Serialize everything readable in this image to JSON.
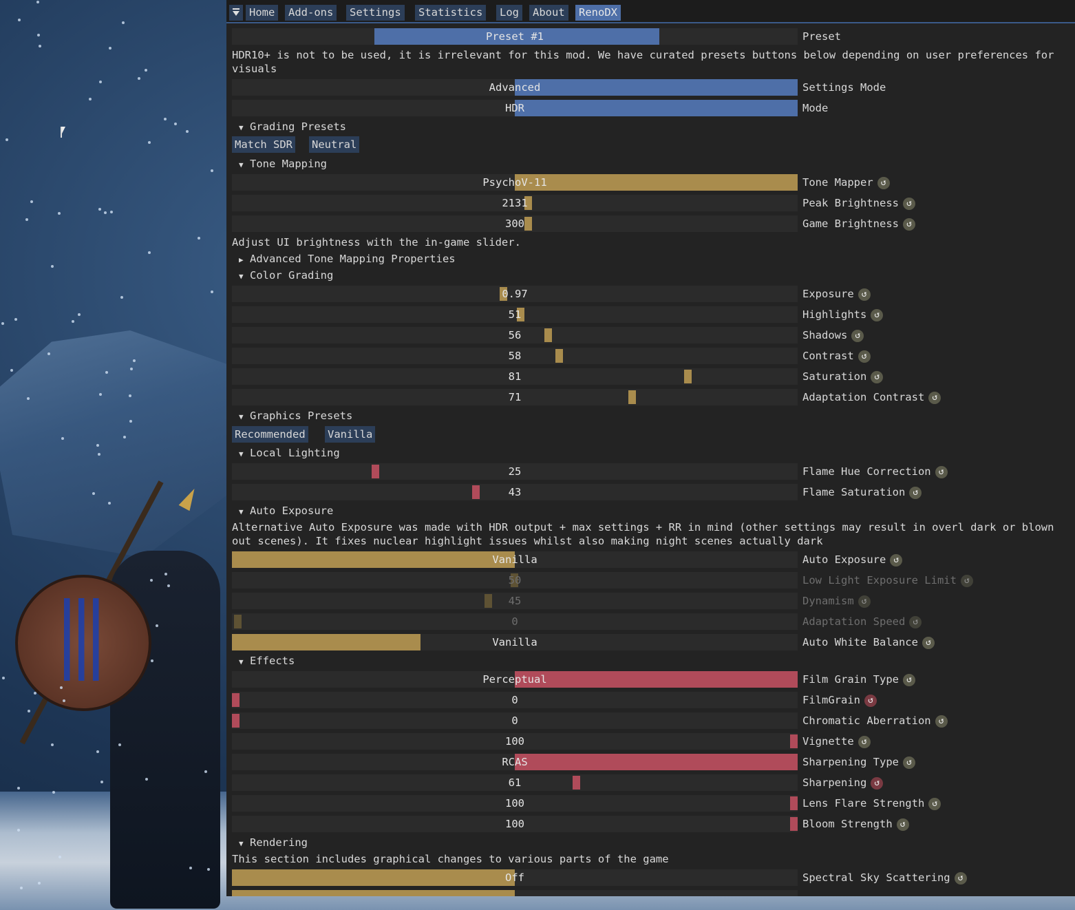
{
  "tabs": [
    "Home",
    "Add-ons",
    "Settings",
    "Statistics",
    "Log",
    "About",
    "RenoDX"
  ],
  "preset": {
    "value": "Preset #1",
    "label": "Preset"
  },
  "hdr_note": "HDR10+ is not to be used, it is irrelevant for this mod. We have curated presets buttons below depending on user preferences for visuals",
  "settings_mode": {
    "value": "Advanced",
    "label": "Settings Mode",
    "level": 0.5
  },
  "mode": {
    "value": "HDR",
    "label": "Mode",
    "level": 0.5
  },
  "sections": {
    "grading_presets": "Grading Presets",
    "tone_mapping": "Tone Mapping",
    "advanced_tm": "Advanced Tone Mapping Properties",
    "color_grading": "Color Grading",
    "graphics_presets": "Graphics Presets",
    "local_lighting": "Local Lighting",
    "auto_exposure": "Auto Exposure",
    "effects": "Effects",
    "rendering": "Rendering"
  },
  "grading_buttons": [
    "Match SDR",
    "Neutral"
  ],
  "graphics_buttons": [
    "Recommended",
    "Vanilla"
  ],
  "tone_mapping": [
    {
      "value": "PsychoV-11",
      "label": "Tone Mapper"
    },
    {
      "value": "2131",
      "label": "Peak Brightness"
    },
    {
      "value": "300",
      "label": "Game Brightness"
    }
  ],
  "ui_note": "Adjust UI brightness with the in-game slider.",
  "color_grading": [
    {
      "value": "0.97",
      "label": "Exposure",
      "level": 0.48
    },
    {
      "value": "51",
      "label": "Highlights",
      "level": 0.51
    },
    {
      "value": "56",
      "label": "Shadows",
      "level": 0.56
    },
    {
      "value": "58",
      "label": "Contrast",
      "level": 0.58
    },
    {
      "value": "81",
      "label": "Saturation",
      "level": 0.81
    },
    {
      "value": "71",
      "label": "Adaptation Contrast",
      "level": 0.71
    }
  ],
  "local_lighting": [
    {
      "value": "25",
      "label": "Flame Hue Correction",
      "level": 0.25
    },
    {
      "value": "43",
      "label": "Flame Saturation",
      "level": 0.43
    }
  ],
  "ae_note": "Alternative Auto Exposure was made with HDR output + max settings + RR in mind (other settings may result in overl dark or blown out scenes). It fixes nuclear highlight issues whilst also making night scenes actually dark",
  "auto_exposure": [
    {
      "value": "Vanilla",
      "label": "Auto Exposure",
      "enabled": true
    },
    {
      "value": "50",
      "label": "Low Light Exposure Limit",
      "enabled": false,
      "level": 0.5
    },
    {
      "value": "45",
      "label": "Dynamism",
      "enabled": false,
      "level": 0.45
    },
    {
      "value": "0",
      "label": "Adaptation Speed",
      "enabled": false,
      "level": 0
    },
    {
      "value": "Vanilla",
      "label": "Auto White Balance",
      "enabled": true
    }
  ],
  "effects": [
    {
      "value": "Perceptual",
      "label": "Film Grain Type"
    },
    {
      "value": "0",
      "label": "FilmGrain",
      "level": 0
    },
    {
      "value": "0",
      "label": "Chromatic Aberration",
      "level": 0
    },
    {
      "value": "100",
      "label": "Vignette",
      "level": 1
    },
    {
      "value": "RCAS",
      "label": "Sharpening Type"
    },
    {
      "value": "61",
      "label": "Sharpening",
      "level": 0.61
    },
    {
      "value": "100",
      "label": "Lens Flare Strength",
      "level": 1
    },
    {
      "value": "100",
      "label": "Bloom Strength",
      "level": 1
    }
  ],
  "rendering_note": "This section includes graphical changes to various parts of the game",
  "rendering": [
    {
      "value": "Off",
      "label": "Spectral Sky Scattering"
    }
  ],
  "icons": {
    "reset": "reset-icon",
    "menu": "menu-icon",
    "cursor": "mouse-cursor-icon"
  },
  "colors": {
    "accent_blue": "#4e6fa8",
    "gold": "#a98c4d",
    "red": "#b04b5a",
    "panel": "#232323"
  }
}
